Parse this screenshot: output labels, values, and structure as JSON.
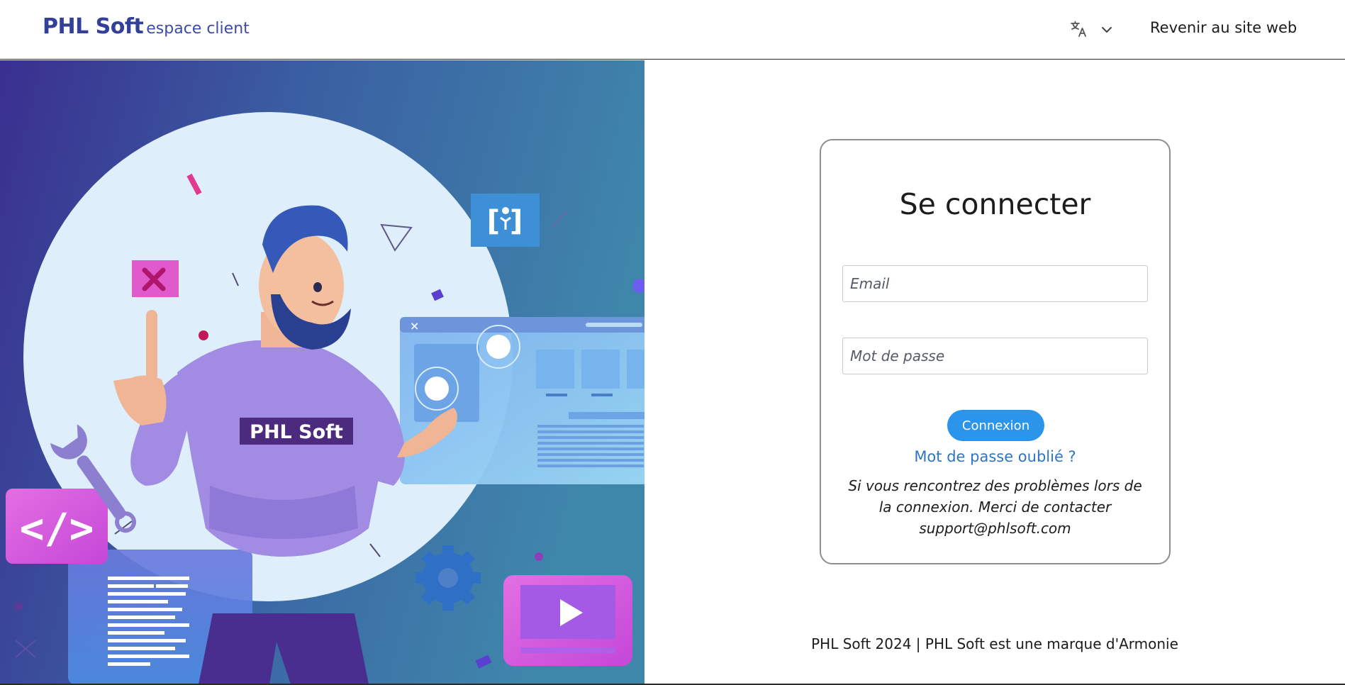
{
  "header": {
    "brand_name": "PHL Soft",
    "brand_sub": "espace client",
    "language_icon": "translate-icon",
    "language_caret_icon": "chevron-down-icon",
    "back_link": "Revenir au site web"
  },
  "hero": {
    "shirt_text": "PHL Soft",
    "illustration": "developer-illustration"
  },
  "login": {
    "title": "Se connecter",
    "email_placeholder": "Email",
    "password_placeholder": "Mot de passe",
    "submit_label": "Connexion",
    "forgot_link": "Mot de passe oublié ?",
    "help_text": "Si vous rencontrez des problèmes lors de la connexion. Merci de contacter support@phlsoft.com"
  },
  "footer": {
    "text": "PHL Soft 2024 | PHL Soft est une marque d'Armonie"
  },
  "colors": {
    "brand": "#33409a",
    "button": "#2b95ec",
    "link": "#2f75c4",
    "hero_gradient_start": "#3a2f8f",
    "hero_gradient_end": "#3f86ab"
  }
}
